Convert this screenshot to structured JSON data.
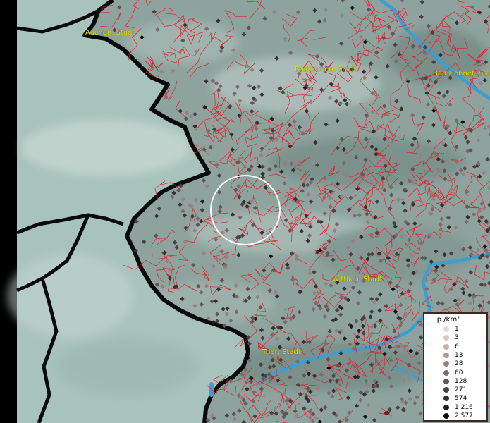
{
  "places": [
    {
      "name": "Aachen, Stadt"
    },
    {
      "name": "Euskirchen, Stadt"
    },
    {
      "name": "Bad Honnef, Stadt"
    },
    {
      "name": "Wittlich, Stadt"
    },
    {
      "name": "Trier, Stadt"
    }
  ],
  "legend": {
    "title": "p./km²",
    "entries": [
      {
        "label": "1",
        "color": "#ead8d8"
      },
      {
        "label": "3",
        "color": "#dcc4c4"
      },
      {
        "label": "6",
        "color": "#c8aeb0"
      },
      {
        "label": "13",
        "color": "#b09698"
      },
      {
        "label": "28",
        "color": "#988082"
      },
      {
        "label": "60",
        "color": "#7e6a6c"
      },
      {
        "label": "128",
        "color": "#645456"
      },
      {
        "label": "271",
        "color": "#4c4042"
      },
      {
        "label": "574",
        "color": "#363030"
      },
      {
        "label": "1 216",
        "color": "#201c1c"
      },
      {
        "label": "2 577",
        "color": "#0c0a0a"
      }
    ]
  },
  "colors": {
    "terrain": "#8fa6a0",
    "outside_area": "#a9c3bd",
    "border": "#0a0a0a",
    "municipality_lines": "#e0202a",
    "rivers": "#3d9fcf",
    "labels": "#e8e000"
  }
}
